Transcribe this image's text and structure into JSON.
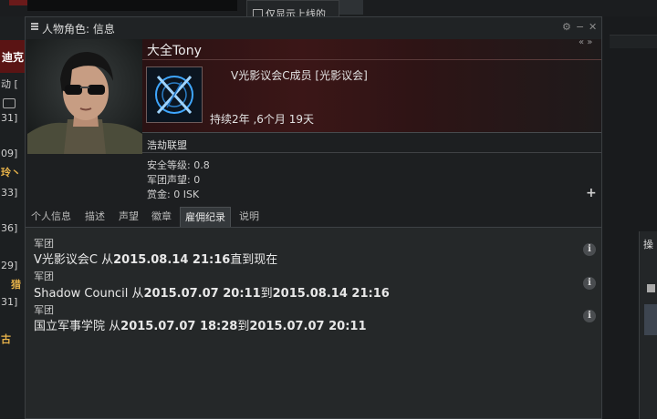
{
  "background": {
    "checkbox_label": "仅显示上线的",
    "left_header": "迪克",
    "left_tab": "动 [",
    "left_lines": [
      "31]",
      "09]",
      "玲丶",
      "33]",
      "36]",
      "29]",
      "猎",
      "31]",
      "古"
    ],
    "right_panel_label": "操"
  },
  "window": {
    "title": "人物角色: 信息",
    "controls": [
      "⚙",
      "−",
      "✕"
    ],
    "nav": "« »"
  },
  "character": {
    "name": "大全Tony",
    "corporation": "V光影议会C成员 [光影议会]",
    "duration": "持续2年 ,6个月 19天",
    "alliance": "浩劫联盟",
    "security_label": "安全等级:",
    "security_value": "0.8",
    "standing_label": "军团声望:",
    "standing_value": "0",
    "bounty_label": "赏金:",
    "bounty_value": "0 ISK",
    "expand": "+"
  },
  "tabs": [
    "个人信息",
    "描述",
    "声望",
    "徽章",
    "雇佣纪录",
    "说明"
  ],
  "active_tab": "雇佣纪录",
  "history": [
    {
      "type": "军团",
      "corp": "V光影议会C",
      "from_word": "从",
      "start": "2015.08.14 21:16",
      "to_word": "直到现在",
      "end": ""
    },
    {
      "type": "军团",
      "corp": "Shadow Council",
      "from_word": "从",
      "start": "2015.07.07 20:11",
      "to_word": "到",
      "end": "2015.08.14 21:16"
    },
    {
      "type": "军团",
      "corp": "国立军事学院",
      "from_word": "从",
      "start": "2015.07.07 18:28",
      "to_word": "到",
      "end": "2015.07.07 20:11"
    }
  ],
  "info_icon": "i",
  "colors": {
    "header_red": "#3b1617",
    "accent_gold": "#e8b34a",
    "logo_blue": "#3fa7ff"
  }
}
